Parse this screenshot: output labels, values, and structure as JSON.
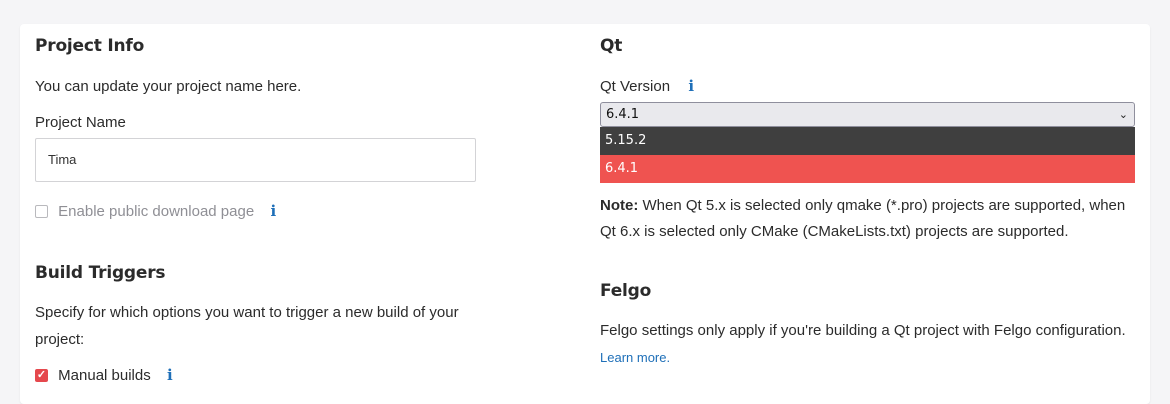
{
  "project_info": {
    "title": "Project Info",
    "description": "You can update your project name here.",
    "name_label": "Project Name",
    "name_value": "Tima",
    "public_download_label": "Enable public download page"
  },
  "build_triggers": {
    "title": "Build Triggers",
    "description_line1": "Specify for which options you want to trigger a new build of your",
    "description_line2": "project:",
    "manual_builds_label": "Manual builds",
    "manual_builds_checked": true
  },
  "qt": {
    "title": "Qt",
    "version_label": "Qt Version",
    "selected_version": "6.4.1",
    "options": [
      "5.15.2",
      "6.4.1"
    ],
    "note_bold": "Note:",
    "note_line1": " When Qt 5.x is selected only qmake (*.pro) projects are supported, when",
    "note_line2": "Qt 6.x is selected only CMake (CMakeLists.txt) projects are supported."
  },
  "felgo": {
    "title": "Felgo",
    "description": "Felgo settings only apply if you're building a Qt project with Felgo configuration.",
    "learn_more": "Learn more."
  },
  "icons": {
    "info": "info-icon",
    "chevron": "chevron-down-icon",
    "check": "checkmark-icon"
  },
  "colors": {
    "accent": "#e5484d",
    "selected_option": "#ef5350",
    "link": "#1e6fb8"
  }
}
